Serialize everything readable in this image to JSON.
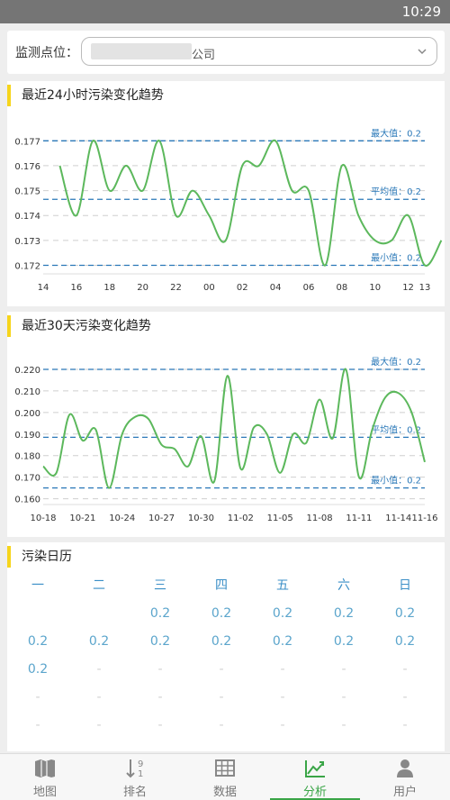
{
  "status_bar": {
    "time": "10:29"
  },
  "monitor": {
    "label": "监测点位：",
    "value_suffix": "公司"
  },
  "chart_data": [
    {
      "type": "line",
      "title": "最近24小时污染变化趋势",
      "x": [
        "14",
        "15",
        "16",
        "17",
        "18",
        "19",
        "20",
        "21",
        "22",
        "23",
        "00",
        "01",
        "02",
        "03",
        "04",
        "05",
        "06",
        "07",
        "08",
        "09",
        "10",
        "11",
        "12",
        "13"
      ],
      "tick_labels": [
        "14",
        "16",
        "18",
        "20",
        "22",
        "00",
        "02",
        "04",
        "06",
        "08",
        "10",
        "12",
        "13"
      ],
      "series": [
        {
          "values": [
            null,
            0.176,
            0.174,
            0.177,
            0.175,
            0.176,
            0.175,
            0.177,
            0.174,
            0.175,
            0.174,
            0.173,
            0.176,
            0.176,
            0.177,
            0.175,
            0.175,
            0.172,
            0.176,
            0.174,
            0.173,
            0.173,
            0.174,
            0.172,
            0.173
          ]
        }
      ],
      "ylim": [
        0.1718,
        0.1773
      ],
      "yticks": [
        0.172,
        0.173,
        0.174,
        0.175,
        0.176,
        0.177
      ],
      "reference_lines": [
        {
          "label": "最大值：0.2",
          "value": 0.177
        },
        {
          "label": "平均值：0.2",
          "value": 0.17465
        },
        {
          "label": "最小值：0.2",
          "value": 0.172
        }
      ],
      "line_color": "#5cb85c",
      "ref_color": "#2a78b8",
      "grid": true
    },
    {
      "type": "line",
      "title": "最近30天污染变化趋势",
      "x": [
        "10-18",
        "10-19",
        "10-20",
        "10-21",
        "10-22",
        "10-23",
        "10-24",
        "10-25",
        "10-26",
        "10-27",
        "10-28",
        "10-29",
        "10-30",
        "10-31",
        "11-01",
        "11-02",
        "11-03",
        "11-04",
        "11-05",
        "11-06",
        "11-07",
        "11-08",
        "11-09",
        "11-10",
        "11-11",
        "11-12",
        "11-13",
        "11-14",
        "11-15",
        "11-16"
      ],
      "tick_labels": [
        "10-18",
        "10-21",
        "10-24",
        "10-27",
        "10-30",
        "11-02",
        "11-05",
        "11-08",
        "11-11",
        "11-14",
        "11-16"
      ],
      "series": [
        {
          "values": [
            0.175,
            0.172,
            0.199,
            0.187,
            0.192,
            0.165,
            0.19,
            0.198,
            0.197,
            0.185,
            0.183,
            0.175,
            0.189,
            0.168,
            0.217,
            0.174,
            0.193,
            0.19,
            0.172,
            0.19,
            0.186,
            0.206,
            0.188,
            0.22,
            0.17,
            0.192,
            0.207,
            0.209,
            0.2,
            0.177
          ]
        }
      ],
      "ylim": [
        0.159,
        0.2225
      ],
      "yticks": [
        0.16,
        0.17,
        0.18,
        0.19,
        0.2,
        0.21,
        0.22
      ],
      "reference_lines": [
        {
          "label": "最大值：0.2",
          "value": 0.22
        },
        {
          "label": "平均值：0.2",
          "value": 0.1885
        },
        {
          "label": "最小值：0.2",
          "value": 0.165
        }
      ],
      "line_color": "#5cb85c",
      "ref_color": "#2a78b8",
      "grid": true
    }
  ],
  "calendar": {
    "title": "污染日历",
    "weekdays": [
      "一",
      "二",
      "三",
      "四",
      "五",
      "六",
      "日"
    ],
    "rows": [
      [
        "",
        "",
        "0.2",
        "0.2",
        "0.2",
        "0.2",
        "0.2"
      ],
      [
        "0.2",
        "0.2",
        "0.2",
        "0.2",
        "0.2",
        "0.2",
        "0.2"
      ],
      [
        "0.2",
        "-",
        "-",
        "-",
        "-",
        "-",
        "-"
      ],
      [
        "-",
        "-",
        "-",
        "-",
        "-",
        "-",
        "-"
      ],
      [
        "-",
        "-",
        "-",
        "-",
        "-",
        "-",
        "-"
      ]
    ]
  },
  "tabs": [
    {
      "label": "地图",
      "icon": "map-icon",
      "active": false
    },
    {
      "label": "排名",
      "icon": "sort-icon",
      "active": false
    },
    {
      "label": "数据",
      "icon": "table-icon",
      "active": false
    },
    {
      "label": "分析",
      "icon": "chart-icon",
      "active": true
    },
    {
      "label": "用户",
      "icon": "user-icon",
      "active": false
    }
  ],
  "colors": {
    "accent": "#3aa547",
    "title_bar": "#f6d51c",
    "calendar_text": "#5ba5cc"
  }
}
